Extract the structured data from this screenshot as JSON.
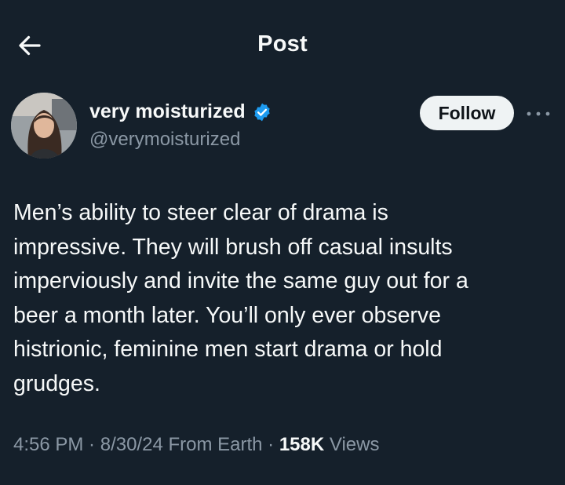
{
  "header": {
    "title": "Post",
    "back_icon": "arrow-left-icon"
  },
  "author": {
    "display_name": "very moisturized",
    "handle": "@verymoisturized",
    "verified": true,
    "verified_color": "#1d9bf0",
    "follow_label": "Follow",
    "more_icon": "more-horizontal-icon"
  },
  "post": {
    "lines": [
      "Men’s ability to steer clear of drama is",
      "impressive. They will brush off casual insults",
      "imperviously and invite the same guy out for a",
      "beer a month later. You’ll only ever observe",
      "histrionic, feminine men start drama or hold",
      "grudges."
    ]
  },
  "meta": {
    "time": "4:56 PM",
    "separator": " · ",
    "date": "8/30/24",
    "source": "From Earth",
    "views_count": "158K",
    "views_label": "Views"
  },
  "colors": {
    "background": "#15202b",
    "text_primary": "#f7f9f9",
    "text_secondary": "#8b98a5",
    "follow_bg": "#eff3f4",
    "follow_text": "#0f1419"
  }
}
